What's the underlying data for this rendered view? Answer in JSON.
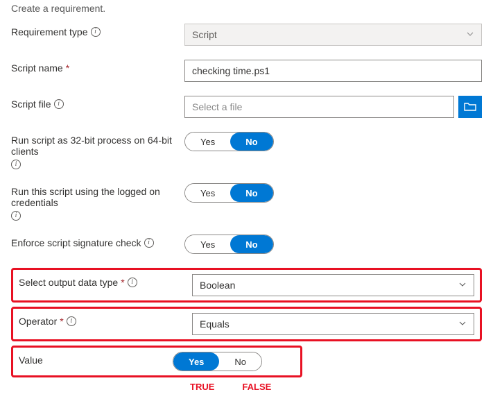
{
  "title": "Create a requirement.",
  "fields": {
    "requirement_type": {
      "label": "Requirement type",
      "value": "Script"
    },
    "script_name": {
      "label": "Script name",
      "value": "checking time.ps1"
    },
    "script_file": {
      "label": "Script file",
      "placeholder": "Select a file"
    },
    "run_32bit": {
      "label": "Run script as 32-bit process on 64-bit clients",
      "yes": "Yes",
      "no": "No",
      "value": "No"
    },
    "run_logged_on": {
      "label": "Run this script using the logged on credentials",
      "yes": "Yes",
      "no": "No",
      "value": "No"
    },
    "enforce_sig": {
      "label": "Enforce script signature check",
      "yes": "Yes",
      "no": "No",
      "value": "No"
    },
    "output_type": {
      "label": "Select output data type",
      "value": "Boolean"
    },
    "operator": {
      "label": "Operator",
      "value": "Equals"
    },
    "value_field": {
      "label": "Value",
      "yes": "Yes",
      "no": "No",
      "value": "Yes"
    }
  },
  "annotations": {
    "true": "TRUE",
    "false": "FALSE"
  }
}
